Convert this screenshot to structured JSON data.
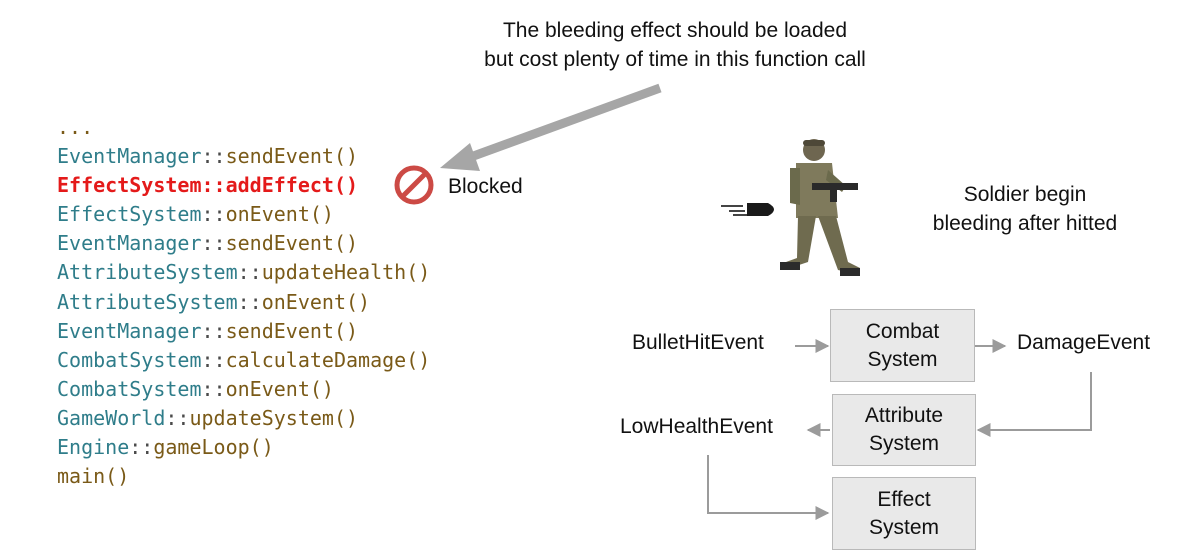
{
  "callout": {
    "line1": "The bleeding effect should be loaded",
    "line2": "but cost plenty of time in this function call"
  },
  "call_stack": [
    {
      "text": "..."
    },
    {
      "cls": "EventManager",
      "fn": "sendEvent()"
    },
    {
      "cls": "EffectSystem",
      "fn": "addEffect()",
      "highlight": true
    },
    {
      "cls": "EffectSystem",
      "fn": "onEvent()"
    },
    {
      "cls": "EventManager",
      "fn": "sendEvent()"
    },
    {
      "cls": "AttributeSystem",
      "fn": "updateHealth()"
    },
    {
      "cls": "AttributeSystem",
      "fn": "onEvent()"
    },
    {
      "cls": "EventManager",
      "fn": "sendEvent()"
    },
    {
      "cls": "CombatSystem",
      "fn": "calculateDamage()"
    },
    {
      "cls": "CombatSystem",
      "fn": "onEvent()"
    },
    {
      "cls": "GameWorld",
      "fn": "updateSystem()"
    },
    {
      "cls": "Engine",
      "fn": "gameLoop()"
    },
    {
      "text": "main()"
    }
  ],
  "separator": "::",
  "blocked_label": "Blocked",
  "soldier_caption": {
    "line1": "Soldier begin",
    "line2": "bleeding after hitted"
  },
  "flow": {
    "bullet_hit_event": "BulletHitEvent",
    "damage_event": "DamageEvent",
    "low_health_event": "LowHealthEvent",
    "combat_system": "Combat System",
    "attribute_system": "Attribute System",
    "effect_system": "Effect System"
  },
  "icons": {
    "blocked": "no-entry-icon",
    "bullet": "bullet-icon",
    "soldier": "soldier-figure"
  },
  "colors": {
    "highlight": "#e41a1a",
    "blocked_icon": "#cc4a45",
    "box_fill": "#e9e9e9",
    "arrow": "#9b9b9b"
  }
}
